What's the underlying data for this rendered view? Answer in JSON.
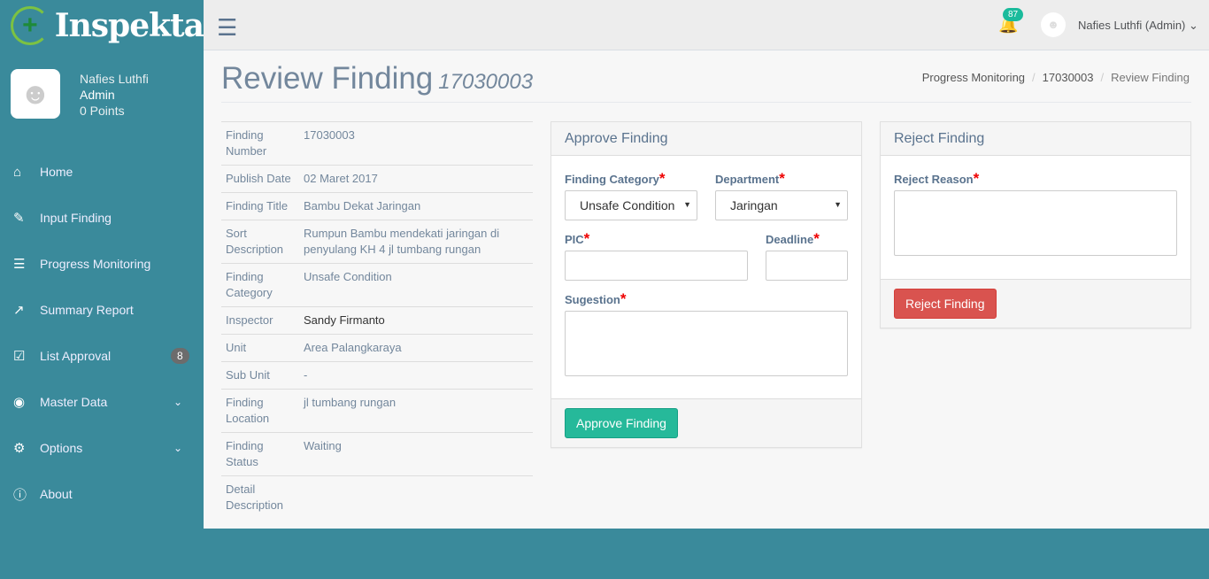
{
  "app": {
    "logo_text": "Inspekta"
  },
  "profile": {
    "name": "Nafies Luthfi",
    "role": "Admin",
    "points": "0 Points"
  },
  "sidebar": {
    "items": [
      {
        "label": "Home",
        "icon": "home-icon"
      },
      {
        "label": "Input Finding",
        "icon": "edit-icon"
      },
      {
        "label": "Progress Monitoring",
        "icon": "list-icon"
      },
      {
        "label": "Summary Report",
        "icon": "chart-icon"
      },
      {
        "label": "List Approval",
        "icon": "check-square-icon",
        "badge": "8"
      },
      {
        "label": "Master Data",
        "icon": "dashboard-icon"
      },
      {
        "label": "Options",
        "icon": "gears-icon"
      },
      {
        "label": "About",
        "icon": "question-icon"
      }
    ]
  },
  "topbar": {
    "notifications": "87",
    "user": "Nafies Luthfi (Admin)"
  },
  "page": {
    "title": "Review Finding",
    "subtitle": "17030003"
  },
  "breadcrumb": [
    "Progress Monitoring",
    "17030003",
    "Review Finding"
  ],
  "details": [
    {
      "k": "Finding Number",
      "v": "17030003"
    },
    {
      "k": "Publish Date",
      "v": "02 Maret 2017"
    },
    {
      "k": "Finding Title",
      "v": "Bambu Dekat Jaringan"
    },
    {
      "k": "Sort Description",
      "v": "Rumpun Bambu mendekati jaringan di penyulang KH 4 jl tumbang rungan"
    },
    {
      "k": "Finding Category",
      "v": "Unsafe Condition"
    },
    {
      "k": "Inspector",
      "v": "Sandy Firmanto"
    },
    {
      "k": "Unit",
      "v": "Area Palangkaraya"
    },
    {
      "k": "Sub Unit",
      "v": "-"
    },
    {
      "k": "Finding Location",
      "v": "jl tumbang rungan"
    },
    {
      "k": "Finding Status",
      "v": "Waiting"
    },
    {
      "k": "Detail Description",
      "v": ""
    }
  ],
  "approve": {
    "header": "Approve Finding",
    "category_label": "Finding Category",
    "category_value": "Unsafe Condition",
    "department_label": "Department",
    "department_value": "Jaringan",
    "pic_label": "PIC",
    "deadline_label": "Deadline",
    "suggestion_label": "Sugestion",
    "button": "Approve Finding",
    "required": "*"
  },
  "reject": {
    "header": "Reject Finding",
    "reason_label": "Reject Reason",
    "button": "Reject Finding"
  },
  "colors": {
    "sidebar": "#3a8a9b",
    "approve": "#26b99a",
    "reject": "#d9534f"
  }
}
